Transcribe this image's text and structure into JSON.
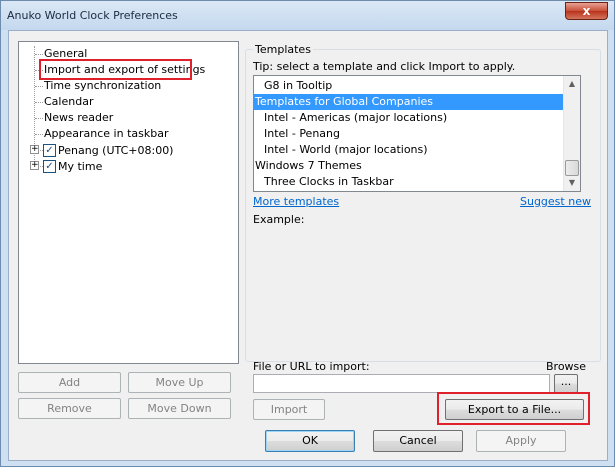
{
  "window": {
    "title": "Anuko World Clock Preferences",
    "close_glyph": "x"
  },
  "tree": {
    "items": [
      {
        "label": "General"
      },
      {
        "label": "Import and export of settings"
      },
      {
        "label": "Time synchronization"
      },
      {
        "label": "Calendar"
      },
      {
        "label": "News reader"
      },
      {
        "label": "Appearance in taskbar"
      },
      {
        "label": "Penang (UTC+08:00)",
        "checked": true,
        "expander": "+"
      },
      {
        "label": "My time",
        "checked": true,
        "expander": "+"
      }
    ],
    "check_glyph": "✓"
  },
  "left_buttons": {
    "add": "Add",
    "move_up": "Move Up",
    "remove": "Remove",
    "move_down": "Move Down"
  },
  "templates": {
    "group_label": "Templates",
    "tip": "Tip: select a template and click Import to apply.",
    "list": [
      {
        "label": "G8 in Tooltip",
        "indent": 1
      },
      {
        "label": "Templates for Global Companies",
        "indent": 0,
        "selected": true
      },
      {
        "label": "Intel - Americas (major locations)",
        "indent": 1
      },
      {
        "label": "Intel - Penang",
        "indent": 1
      },
      {
        "label": "Intel - World (major locations)",
        "indent": 1
      },
      {
        "label": "Windows 7 Themes",
        "indent": 0
      },
      {
        "label": "Three Clocks in Taskbar",
        "indent": 1
      }
    ],
    "more_link": "More templates",
    "suggest_link": "Suggest new",
    "example_label": "Example:"
  },
  "import": {
    "file_label": "File or URL to import:",
    "browse_label": "Browse",
    "browse_button": "...",
    "file_value": "",
    "import_button": "Import",
    "export_button": "Export to a File..."
  },
  "dialog": {
    "ok": "OK",
    "cancel": "Cancel",
    "apply": "Apply"
  },
  "colors": {
    "highlight": "#e0202a",
    "selection": "#3399ff",
    "link": "#0066cc"
  }
}
